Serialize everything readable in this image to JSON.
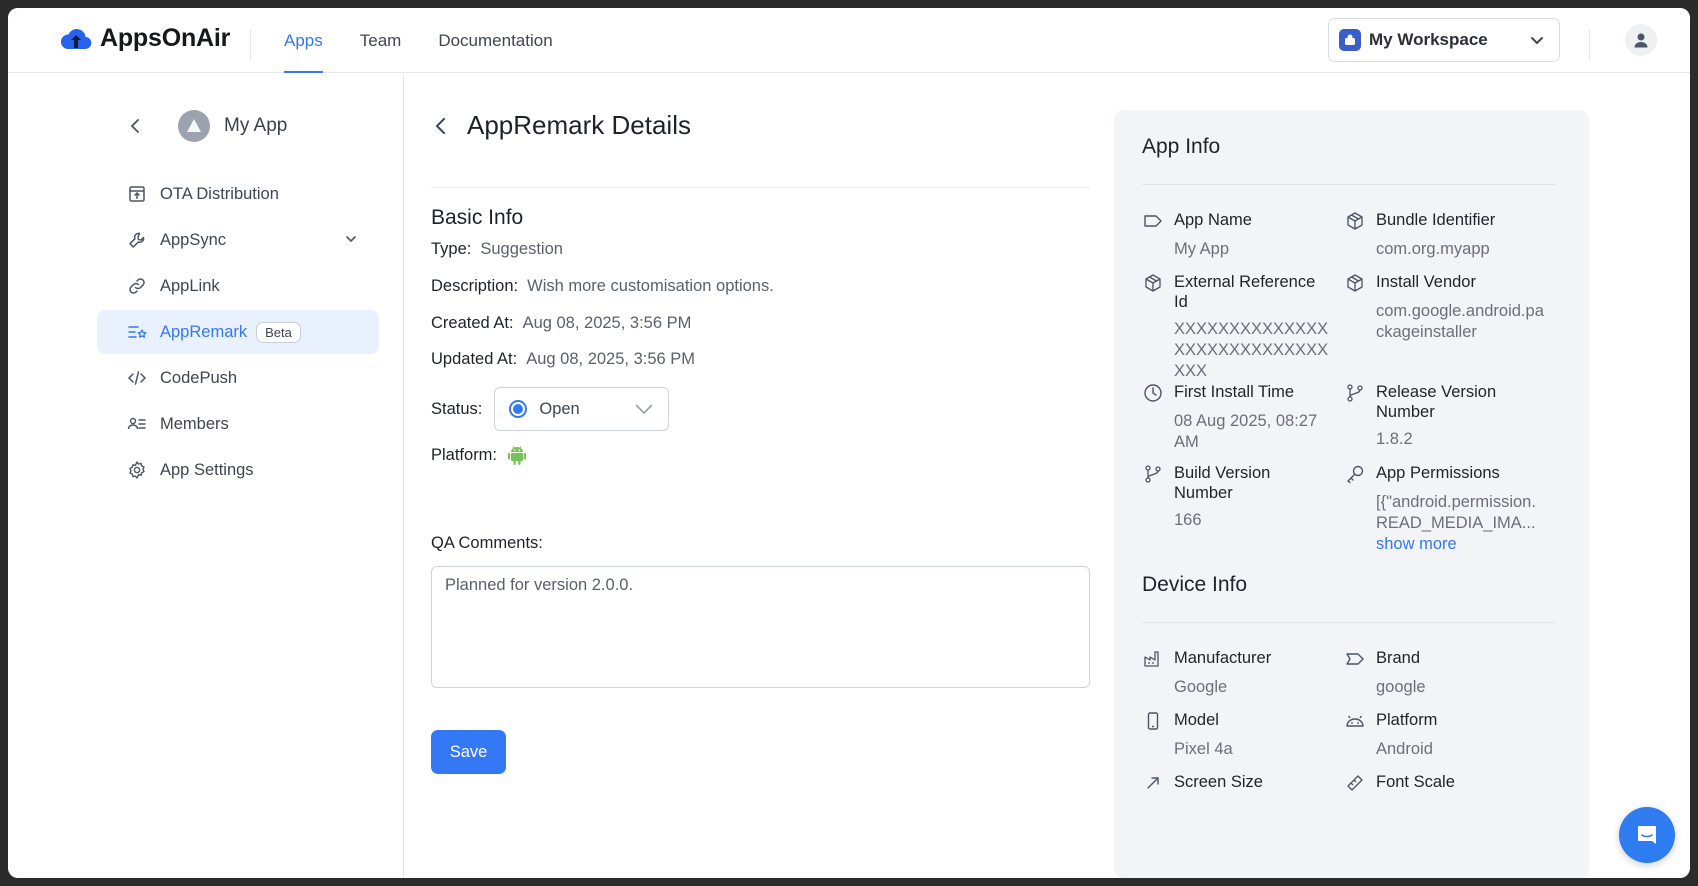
{
  "brand": {
    "name": "AppsOnAir"
  },
  "nav": {
    "items": [
      {
        "label": "Apps"
      },
      {
        "label": "Team"
      },
      {
        "label": "Documentation"
      }
    ]
  },
  "workspace": {
    "name": "My Workspace"
  },
  "sidebar": {
    "app_name": "My App",
    "items": [
      {
        "label": "OTA Distribution"
      },
      {
        "label": "AppSync"
      },
      {
        "label": "AppLink"
      },
      {
        "label": "AppRemark",
        "badge": "Beta"
      },
      {
        "label": "CodePush"
      },
      {
        "label": "Members"
      },
      {
        "label": "App Settings"
      }
    ]
  },
  "main": {
    "title": "AppRemark Details",
    "section": "Basic Info",
    "type": {
      "label": "Type:",
      "value": "Suggestion"
    },
    "description": {
      "label": "Description:",
      "value": "Wish more customisation options."
    },
    "created": {
      "label": "Created At:",
      "value": "Aug 08, 2025, 3:56 PM"
    },
    "updated": {
      "label": "Updated At:",
      "value": "Aug 08, 2025, 3:56 PM"
    },
    "status": {
      "label": "Status:",
      "value": "Open"
    },
    "platform": {
      "label": "Platform:",
      "icon": "android-icon",
      "color": "#78c257"
    },
    "qa": {
      "label": "QA Comments:",
      "value": "Planned for version 2.0.0."
    },
    "save_label": "Save"
  },
  "app_info": {
    "title": "App Info",
    "items": [
      {
        "label": "App Name",
        "value": "My App",
        "icon": "tag-icon"
      },
      {
        "label": "Bundle Identifier",
        "value": "com.org.myapp",
        "icon": "box-icon"
      },
      {
        "label": "External Reference Id",
        "value": "XXXXXXXXXXXXXXXXXXXXXXXXXXXXXXX",
        "icon": "box-icon"
      },
      {
        "label": "Install Vendor",
        "value": "com.google.android.packageinstaller",
        "icon": "box-icon"
      },
      {
        "label": "First Install Time",
        "value": "08 Aug 2025, 08:27 AM",
        "icon": "clock-icon"
      },
      {
        "label": "Release Version Number",
        "value": "1.8.2",
        "icon": "branch-icon"
      },
      {
        "label": "Build Version Number",
        "value": "166",
        "icon": "branch-icon"
      },
      {
        "label": "App Permissions",
        "value": "[{\"android.permission.READ_MEDIA_IMA...",
        "icon": "key-icon",
        "show_more": "show more"
      }
    ]
  },
  "device_info": {
    "title": "Device Info",
    "items": [
      {
        "label": "Manufacturer",
        "value": "Google",
        "icon": "factory-icon"
      },
      {
        "label": "Brand",
        "value": "google",
        "icon": "tag-icon"
      },
      {
        "label": "Model",
        "value": "Pixel 4a",
        "icon": "phone-icon"
      },
      {
        "label": "Platform",
        "value": "Android",
        "icon": "android-outline-icon"
      },
      {
        "label": "Screen Size",
        "value": "",
        "icon": "resize-icon"
      },
      {
        "label": "Font Scale",
        "value": "",
        "icon": "ruler-icon"
      }
    ]
  },
  "colors": {
    "accent": "#3478f6",
    "active_bg": "#e8f1fd",
    "panel_bg": "#f3f4f7"
  }
}
